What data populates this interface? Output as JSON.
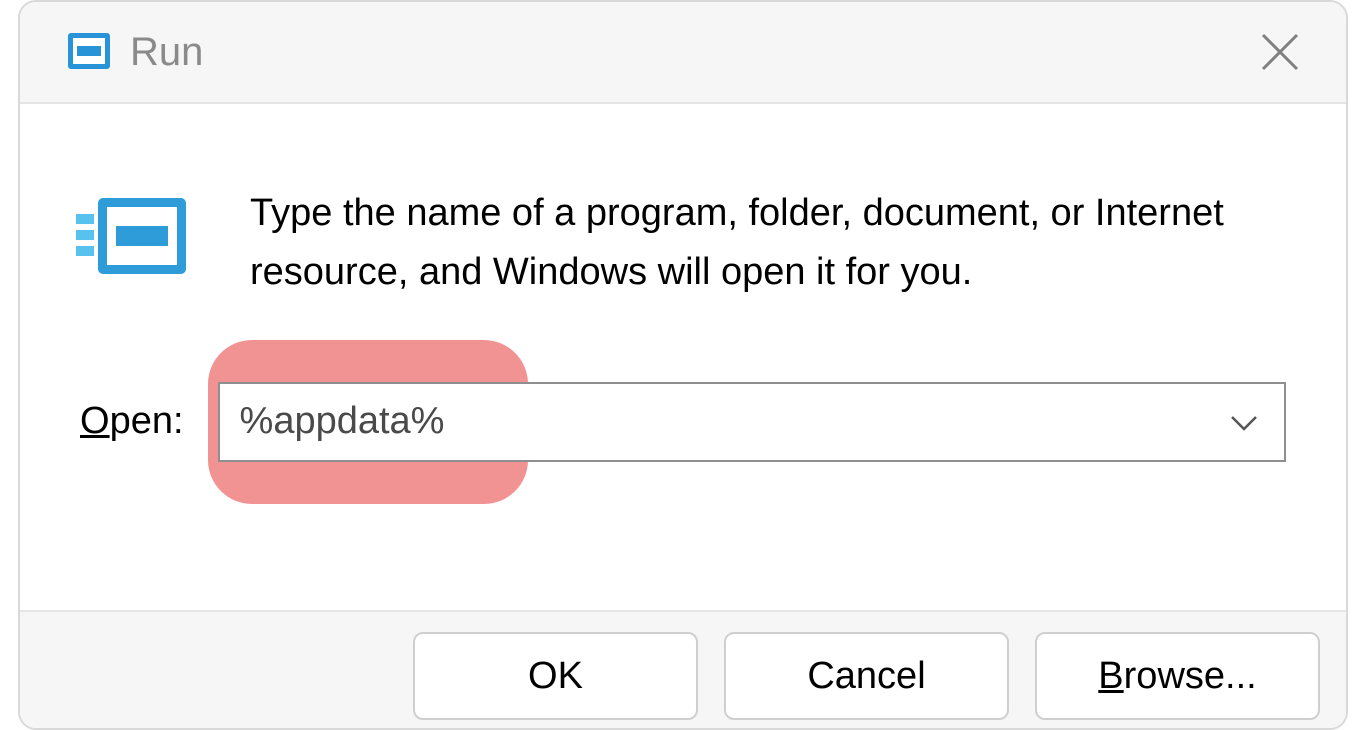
{
  "title": "Run",
  "description": "Type the name of a program, folder, document, or Internet resource, and Windows will open it for you.",
  "open_label_letter": "O",
  "open_label_rest": "pen:",
  "open_value": "%appdata%",
  "buttons": {
    "ok": "OK",
    "cancel": "Cancel",
    "browse_letter": "B",
    "browse_rest": "rowse..."
  }
}
